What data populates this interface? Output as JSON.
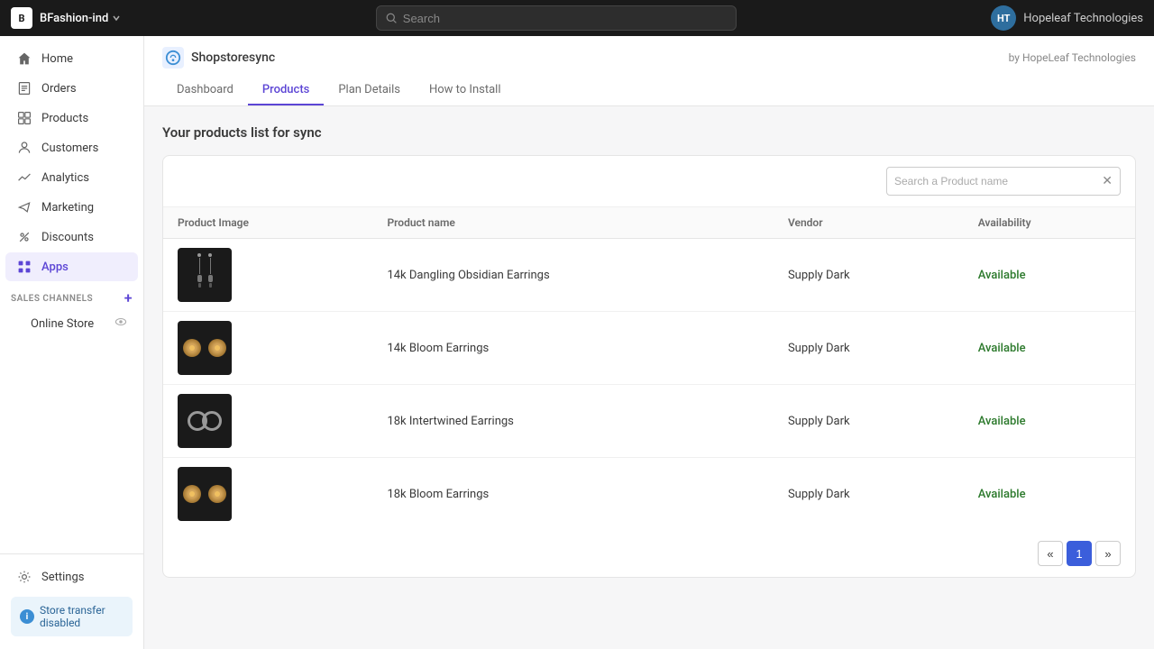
{
  "topbar": {
    "store_icon": "B",
    "store_name": "BFashion-ind",
    "search_placeholder": "Search",
    "avatar_initials": "HT",
    "company_name": "Hopeleaf Technologies"
  },
  "sidebar": {
    "items": [
      {
        "id": "home",
        "label": "Home",
        "icon": "home-icon"
      },
      {
        "id": "orders",
        "label": "Orders",
        "icon": "orders-icon"
      },
      {
        "id": "products",
        "label": "Products",
        "icon": "products-icon"
      },
      {
        "id": "customers",
        "label": "Customers",
        "icon": "customers-icon"
      },
      {
        "id": "analytics",
        "label": "Analytics",
        "icon": "analytics-icon"
      },
      {
        "id": "marketing",
        "label": "Marketing",
        "icon": "marketing-icon"
      },
      {
        "id": "discounts",
        "label": "Discounts",
        "icon": "discounts-icon"
      },
      {
        "id": "apps",
        "label": "Apps",
        "icon": "apps-icon",
        "active": true
      }
    ],
    "sales_channels_label": "SALES CHANNELS",
    "online_store_label": "Online Store",
    "settings_label": "Settings",
    "store_transfer_label": "Store transfer disabled"
  },
  "app": {
    "logo": "S",
    "name": "Shopstoresync",
    "by_line": "by HopeLeaf Technologies",
    "tabs": [
      {
        "id": "dashboard",
        "label": "Dashboard"
      },
      {
        "id": "products",
        "label": "Products",
        "active": true
      },
      {
        "id": "plan-details",
        "label": "Plan Details"
      },
      {
        "id": "how-to-install",
        "label": "How to Install"
      }
    ]
  },
  "products_page": {
    "heading": "Your products list for sync",
    "search_placeholder": "Search a Product name",
    "table": {
      "columns": [
        "Product Image",
        "Product name",
        "Vendor",
        "Availability"
      ],
      "rows": [
        {
          "id": 1,
          "name": "14k Dangling Obsidian Earrings",
          "vendor": "Supply Dark",
          "availability": "Available",
          "img_type": "dangle"
        },
        {
          "id": 2,
          "name": "14k Bloom Earrings",
          "vendor": "Supply Dark",
          "availability": "Available",
          "img_type": "bloom"
        },
        {
          "id": 3,
          "name": "18k Intertwined Earrings",
          "vendor": "Supply Dark",
          "availability": "Available",
          "img_type": "intertwined"
        },
        {
          "id": 4,
          "name": "18k Bloom Earrings",
          "vendor": "Supply Dark",
          "availability": "Available",
          "img_type": "bloom"
        }
      ]
    },
    "pagination": {
      "prev": "«",
      "current": 1,
      "next": "»"
    }
  }
}
